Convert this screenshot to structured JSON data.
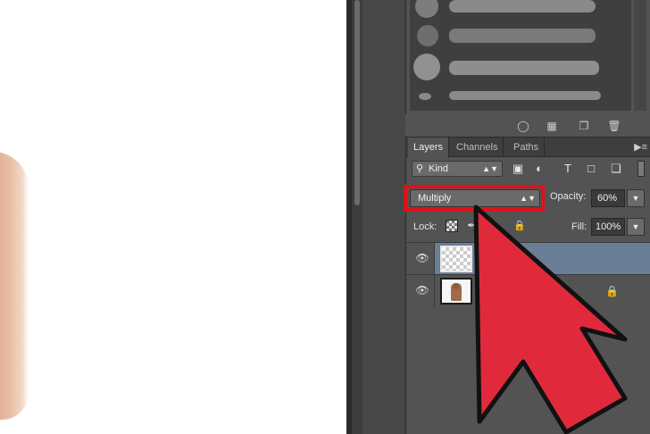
{
  "brush_panel": {
    "footer_icons": [
      "brush-preview-icon",
      "create-brush-icon",
      "new-preset-icon",
      "trash-icon"
    ]
  },
  "layers_panel": {
    "tabs": [
      {
        "label": "Layers",
        "active": true
      },
      {
        "label": "Channels",
        "active": false
      },
      {
        "label": "Paths",
        "active": false
      }
    ],
    "menu_icon": "panel-menu-icon",
    "filter": {
      "kind_label": "Kind",
      "icons": [
        "image-filter-icon",
        "adjustment-filter-icon",
        "type-filter-icon",
        "shape-filter-icon",
        "smart-object-filter-icon"
      ]
    },
    "blend_mode": "Multiply",
    "opacity_label": "Opacity:",
    "opacity_value": "60%",
    "lock_label": "Lock:",
    "fill_label": "Fill:",
    "fill_value": "100%",
    "layers": [
      {
        "name": "",
        "thumbnail": "transparent",
        "selected": true,
        "visible": true,
        "locked": false
      },
      {
        "name": "",
        "thumbnail": "photo",
        "selected": false,
        "visible": true,
        "locked": true
      }
    ]
  },
  "colors": {
    "highlight": "#e0101a",
    "cursor_fill": "#e02a3c",
    "selected_layer": "#6a7e96",
    "panel_bg": "#535353"
  }
}
